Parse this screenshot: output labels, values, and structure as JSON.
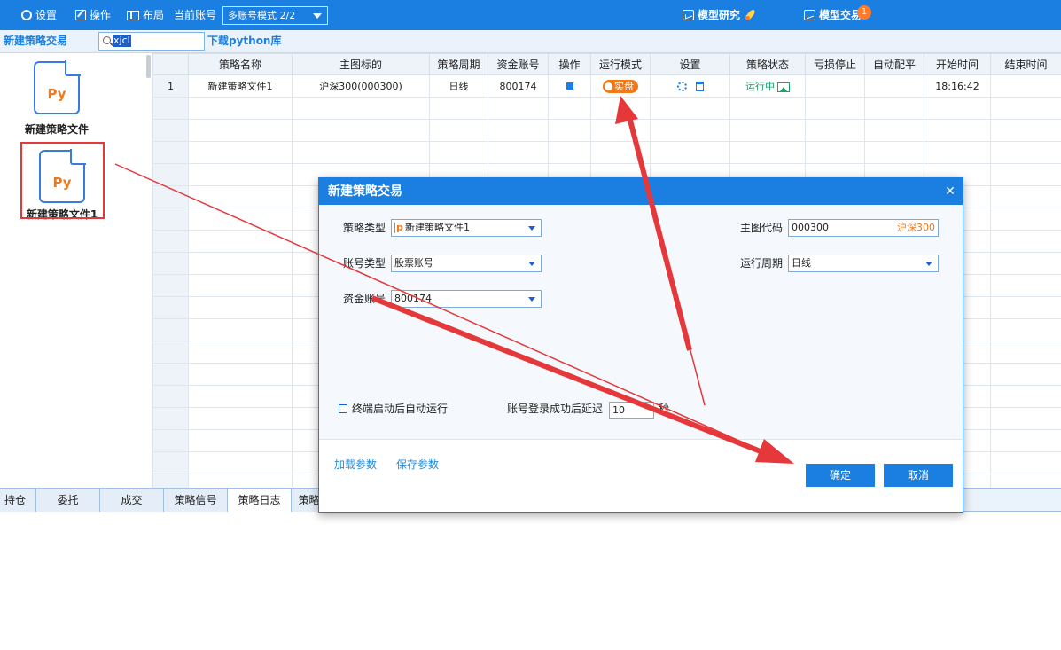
{
  "toolbar": {
    "settings": "设置",
    "operate": "操作",
    "layout": "布局",
    "current_account_label": "当前账号",
    "account_mode": "多账号模式 2/2",
    "model_research": "模型研究",
    "model_trade": "模型交易",
    "notification_count": "1"
  },
  "subbar": {
    "title": "新建策略交易",
    "search_value": "xjcl",
    "download_link": "下载python库"
  },
  "files": [
    {
      "icon_text": "Py",
      "name": "新建策略文件"
    },
    {
      "icon_text": "Py",
      "name": "新建策略文件1"
    }
  ],
  "grid": {
    "columns": [
      "策略名称",
      "主图标的",
      "策略周期",
      "资金账号",
      "操作",
      "运行模式",
      "设置",
      "策略状态",
      "亏损停止",
      "自动配平",
      "开始时间",
      "结束时间"
    ],
    "rows": [
      {
        "index": "1",
        "name": "新建策略文件1",
        "symbol": "沪深300(000300)",
        "period": "日线",
        "account": "800174",
        "run_mode": "实盘",
        "status": "运行中",
        "stop_loss": "",
        "auto_balance": "",
        "start_time": "18:16:42",
        "end_time": ""
      }
    ]
  },
  "bottom_tabs": [
    "持仓",
    "委托",
    "成交",
    "策略信号",
    "策略日志",
    "策略"
  ],
  "active_bottom_tab": "策略日志",
  "dialog": {
    "title": "新建策略交易",
    "strategy_type_label": "策略类型",
    "strategy_type_value": "新建策略文件1",
    "account_type_label": "账号类型",
    "account_type_value": "股票账号",
    "fund_account_label": "资金账号",
    "fund_account_value": "800174",
    "main_code_label": "主图代码",
    "main_code_value": "000300",
    "main_code_name": "沪深300",
    "run_period_label": "运行周期",
    "run_period_value": "日线",
    "autorun_label": "终端启动后自动运行",
    "delay_label": "账号登录成功后延迟",
    "delay_value": "10",
    "delay_unit": "秒",
    "load_params": "加载参数",
    "save_params": "保存参数",
    "confirm": "确定",
    "cancel": "取消"
  },
  "colors": {
    "accent": "#1a7fe0",
    "live_mode": "#f07a1a",
    "running": "#1aa36a",
    "annotation": "#e5383b"
  }
}
